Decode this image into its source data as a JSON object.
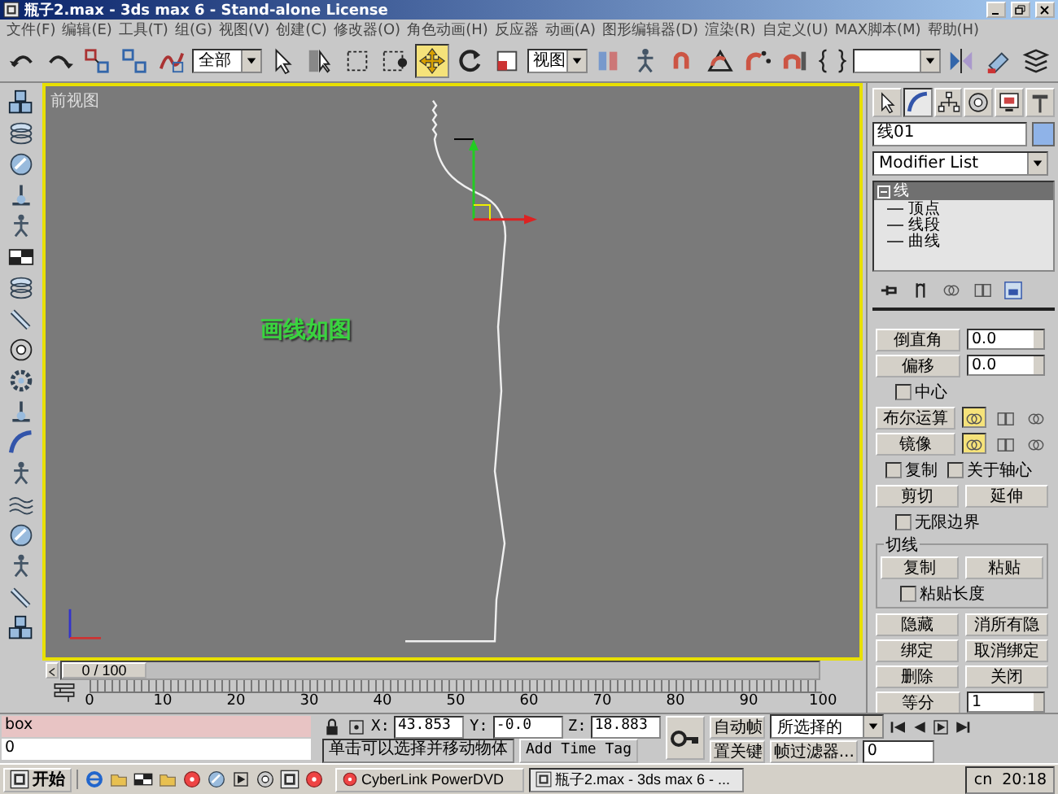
{
  "window": {
    "title": "瓶子2.max - 3ds max 6 - Stand-alone License"
  },
  "menu": [
    "文件(F)",
    "编辑(E)",
    "工具(T)",
    "组(G)",
    "视图(V)",
    "创建(C)",
    "修改器(O)",
    "角色动画(H)",
    "反应器",
    "动画(A)",
    "图形编辑器(D)",
    "渲染(R)",
    "自定义(U)",
    "MAX脚本(M)",
    "帮助(H)"
  ],
  "toolbar": {
    "items": [
      {
        "kind": "tool",
        "selected": false
      },
      {
        "kind": "tool",
        "selected": false
      },
      {
        "kind": "tool",
        "selected": false
      },
      {
        "kind": "tool",
        "selected": false
      },
      {
        "kind": "tool",
        "selected": false
      },
      {
        "kind": "dropdown",
        "value": "全部"
      },
      {
        "kind": "tool",
        "selected": false
      },
      {
        "kind": "tool",
        "selected": false
      },
      {
        "kind": "tool",
        "selected": false
      },
      {
        "kind": "tool",
        "selected": false
      },
      {
        "kind": "tool",
        "selected": true
      },
      {
        "kind": "tool",
        "selected": false
      },
      {
        "kind": "tool",
        "selected": false
      },
      {
        "kind": "dropdown",
        "value": "视图"
      },
      {
        "kind": "tool",
        "selected": false
      },
      {
        "kind": "tool",
        "selected": false
      },
      {
        "kind": "tool",
        "selected": false
      },
      {
        "kind": "tool",
        "selected": false
      },
      {
        "kind": "tool",
        "selected": false
      },
      {
        "kind": "tool",
        "selected": false
      },
      {
        "kind": "tool",
        "selected": false
      },
      {
        "kind": "field"
      },
      {
        "kind": "tool",
        "selected": false
      },
      {
        "kind": "tool",
        "selected": false
      },
      {
        "kind": "tool",
        "selected": false
      }
    ]
  },
  "viewport": {
    "label": "前视图",
    "annotation": "画线如图"
  },
  "timeline": {
    "position": "0 / 100",
    "level": 0,
    "ticks": [
      "0",
      "10",
      "20",
      "30",
      "40",
      "50",
      "60",
      "70",
      "80",
      "90",
      "100"
    ]
  },
  "command_panel": {
    "tabs": [
      {
        "selected": false
      },
      {
        "selected": true
      },
      {
        "selected": false
      },
      {
        "selected": false
      },
      {
        "selected": false
      },
      {
        "selected": false
      }
    ],
    "object_name": "线01",
    "modifier_list": "Modifier List",
    "stack": [
      {
        "label": "线",
        "expanded": true,
        "selected": true,
        "children": [
          {
            "label": "顶点",
            "selected": false
          },
          {
            "label": "线段",
            "selected": false
          },
          {
            "label": "曲线",
            "selected": false
          }
        ]
      }
    ],
    "rollout": [
      {
        "kind": "button-spinner",
        "button": "倒直角",
        "value": "0.0"
      },
      {
        "kind": "button-spinner",
        "button": "偏移",
        "value": "0.0"
      },
      {
        "kind": "checkboxes",
        "items": [
          {
            "label": "中心",
            "checked": false
          }
        ]
      },
      {
        "kind": "button-toggles",
        "button": "布尔运算",
        "toggles": [
          {
            "selected": true
          },
          {
            "selected": false
          },
          {
            "selected": false
          }
        ]
      },
      {
        "kind": "button-toggles",
        "button": "镜像",
        "toggles": [
          {
            "selected": true
          },
          {
            "selected": false
          },
          {
            "selected": false
          }
        ]
      },
      {
        "kind": "checkboxes",
        "items": [
          {
            "label": "复制",
            "checked": false
          },
          {
            "label": "关于轴心",
            "checked": false
          }
        ]
      },
      {
        "kind": "buttons",
        "items": [
          "剪切",
          "延伸"
        ]
      },
      {
        "kind": "checkboxes",
        "items": [
          {
            "label": "无限边界",
            "checked": false
          }
        ]
      },
      {
        "kind": "group",
        "title": "切线",
        "rows": [
          {
            "kind": "buttons",
            "items": [
              "复制",
              "粘贴"
            ]
          },
          {
            "kind": "checkboxes",
            "items": [
              {
                "label": "粘贴长度",
                "checked": false
              }
            ]
          }
        ]
      },
      {
        "kind": "buttons",
        "items": [
          "隐藏",
          "消所有隐"
        ]
      },
      {
        "kind": "buttons",
        "items": [
          "绑定",
          "取消绑定"
        ]
      },
      {
        "kind": "buttons",
        "items": [
          "删除",
          "关闭"
        ]
      },
      {
        "kind": "button-spinner",
        "button": "等分",
        "value": "1"
      }
    ]
  },
  "status": {
    "listener": {
      "input": "box",
      "output": "0"
    },
    "coords": [
      {
        "label": "X:",
        "value": "43.853"
      },
      {
        "label": "Y:",
        "value": "-0.0"
      },
      {
        "label": "Z:",
        "value": "18.883"
      }
    ],
    "prompt": "单击可以选择并移动物体",
    "time_tag": "Add Time Tag",
    "auto_key": "自动帧",
    "key_dropdown": "所选择的",
    "set_key": "置关键",
    "key_filters": "帧过滤器...",
    "frame": "0"
  },
  "taskbar": {
    "start": "开始",
    "tasks": [
      {
        "label": "CyberLink PowerDVD",
        "selected": false
      },
      {
        "label": "瓶子2.max - 3ds max 6 - ...",
        "selected": true
      }
    ],
    "language": "cn",
    "clock": "20:18"
  }
}
